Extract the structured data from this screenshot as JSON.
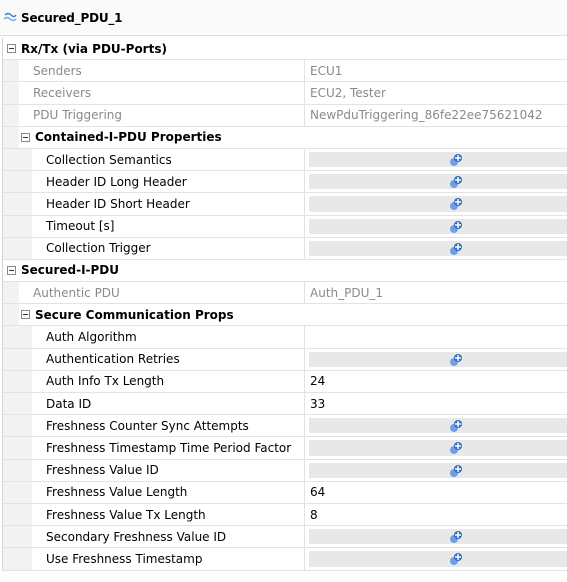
{
  "window": {
    "title": "Secured_PDU_1"
  },
  "sections": {
    "rxtx": {
      "label": "Rx/Tx (via PDU-Ports)",
      "rows": [
        {
          "name": "Senders",
          "value": "ECU1"
        },
        {
          "name": "Receivers",
          "value": "ECU2, Tester"
        },
        {
          "name": "PDU Triggering",
          "value": "NewPduTriggering_86fe22ee75621042"
        }
      ]
    },
    "contained": {
      "label": "Contained-I-PDU Properties",
      "rows": [
        {
          "name": "Collection Semantics",
          "value": ""
        },
        {
          "name": "Header ID Long Header",
          "value": ""
        },
        {
          "name": "Header ID Short Header",
          "value": ""
        },
        {
          "name": "Timeout [s]",
          "value": ""
        },
        {
          "name": "Collection Trigger",
          "value": ""
        }
      ]
    },
    "secured": {
      "label": "Secured-I-PDU",
      "rows": [
        {
          "name": "Authentic PDU",
          "value": "Auth_PDU_1"
        }
      ]
    },
    "secure_comm": {
      "label": "Secure Communication Props",
      "rows": [
        {
          "name": "Auth Algorithm",
          "value": ""
        },
        {
          "name": "Authentication Retries",
          "value": ""
        },
        {
          "name": "Auth Info Tx Length",
          "value": "24"
        },
        {
          "name": "Data ID",
          "value": "33"
        },
        {
          "name": "Freshness Counter Sync Attempts",
          "value": ""
        },
        {
          "name": "Freshness Timestamp Time Period Factor",
          "value": ""
        },
        {
          "name": "Freshness Value ID",
          "value": ""
        },
        {
          "name": "Freshness Value Length",
          "value": "64"
        },
        {
          "name": "Freshness Value Tx Length",
          "value": "8"
        },
        {
          "name": "Secondary Freshness Value ID",
          "value": ""
        },
        {
          "name": "Use Freshness Timestamp",
          "value": ""
        }
      ]
    }
  },
  "icons": {
    "title": "pdu-link-icon",
    "add": "add-value-icon",
    "collapse": "collapse-icon"
  },
  "colors": {
    "readonly_text": "#8a8a8a",
    "empty_value": "#e8e8e8",
    "add_icon": "#2b6cc4"
  }
}
